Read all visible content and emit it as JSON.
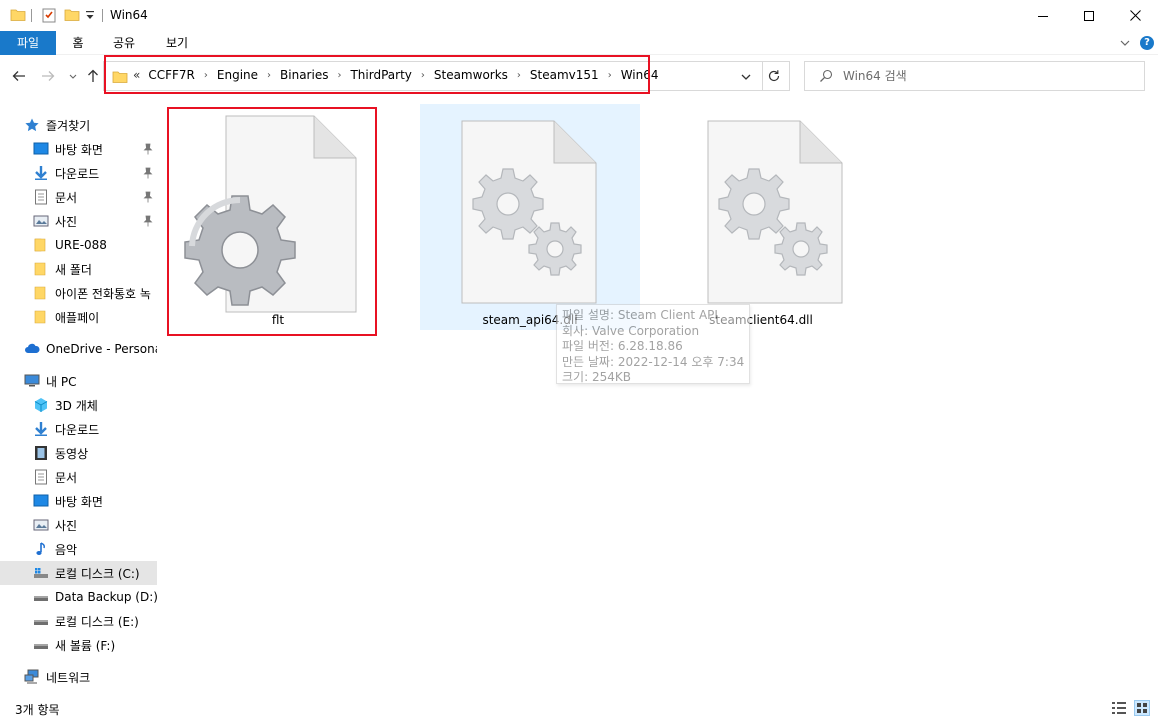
{
  "window": {
    "title": "Win64"
  },
  "ribbon": {
    "tabs": [
      {
        "label": "파일"
      },
      {
        "label": "홈"
      },
      {
        "label": "공유"
      },
      {
        "label": "보기"
      }
    ]
  },
  "address": {
    "overflow": "«",
    "crumbs": [
      "CCFF7R",
      "Engine",
      "Binaries",
      "ThirdParty",
      "Steamworks",
      "Steamv151",
      "Win64"
    ]
  },
  "search": {
    "placeholder": "Win64 검색"
  },
  "sidebar": {
    "items": [
      {
        "label": "즐겨찾기"
      },
      {
        "label": "바탕 화면"
      },
      {
        "label": "다운로드"
      },
      {
        "label": "문서"
      },
      {
        "label": "사진"
      },
      {
        "label": "URE-088"
      },
      {
        "label": "새 폴더"
      },
      {
        "label": "아이폰 전화통호 녹"
      },
      {
        "label": "애플페이"
      },
      {
        "label": "OneDrive - Personal"
      },
      {
        "label": "내 PC"
      },
      {
        "label": "3D 개체"
      },
      {
        "label": "다운로드"
      },
      {
        "label": "동영상"
      },
      {
        "label": "문서"
      },
      {
        "label": "바탕 화면"
      },
      {
        "label": "사진"
      },
      {
        "label": "음악"
      },
      {
        "label": "로컬 디스크 (C:)"
      },
      {
        "label": "Data Backup (D:)"
      },
      {
        "label": "로컬 디스크 (E:)"
      },
      {
        "label": "새 볼륨 (F:)"
      },
      {
        "label": "네트워크"
      }
    ]
  },
  "files": [
    {
      "name": "flt",
      "icon": "large-gear-icon"
    },
    {
      "name": "steam_api64.dll",
      "icon": "dll-gears-icon"
    },
    {
      "name": "steamclient64.dll",
      "icon": "dll-gears-icon"
    }
  ],
  "tooltip": {
    "lines": [
      "파일 설명: Steam Client API",
      "회사: Valve Corporation",
      "파일 버전: 6.28.18.86",
      "만든 날짜: 2022-12-14 오후 7:34",
      "크기: 254KB"
    ]
  },
  "status": {
    "count": "3개 항목"
  },
  "colors": {
    "accent": "#1979ca",
    "highlight_box": "#e81123",
    "hover_bg": "#e5f3ff",
    "selected_bg": "#e5e5e5",
    "folder_yellow": "#ffd766"
  }
}
